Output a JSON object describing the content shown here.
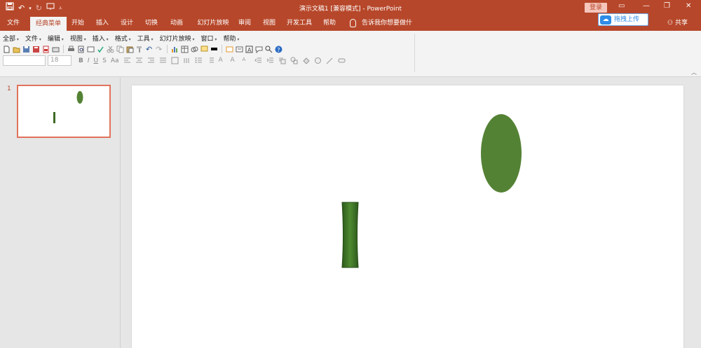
{
  "titlebar": {
    "title": "演示文稿1 [兼容模式]  -  PowerPoint",
    "login_label": "登录",
    "qat_icons": [
      "save-icon",
      "undo-icon",
      "redo-icon",
      "slideshow-icon",
      "customize-icon"
    ]
  },
  "tabs": [
    {
      "label": "文件"
    },
    {
      "label": "经典菜单",
      "active": true
    },
    {
      "label": "开始"
    },
    {
      "label": "插入"
    },
    {
      "label": "设计"
    },
    {
      "label": "切换"
    },
    {
      "label": "动画"
    },
    {
      "label": "幻灯片放映"
    },
    {
      "label": "审阅"
    },
    {
      "label": "视图"
    },
    {
      "label": "开发工具"
    },
    {
      "label": "帮助"
    }
  ],
  "tell_me": "告诉我你想要做什么",
  "share_label": "共享",
  "upload_label": "拖拽上传",
  "menu_row": [
    "全部",
    "文件",
    "编辑",
    "视图",
    "插入",
    "格式",
    "工具",
    "幻灯片放映",
    "窗口",
    "帮助"
  ],
  "font": {
    "name": "",
    "size": "18"
  },
  "format_buttons": {
    "bold": "B",
    "italic": "I",
    "underline": "U",
    "shadow": "S",
    "case": "Aa"
  },
  "slides": {
    "current_number": "1"
  },
  "colors": {
    "accent": "#b7472a",
    "shape_green": "#548235",
    "thumb_border": "#e0735b"
  }
}
